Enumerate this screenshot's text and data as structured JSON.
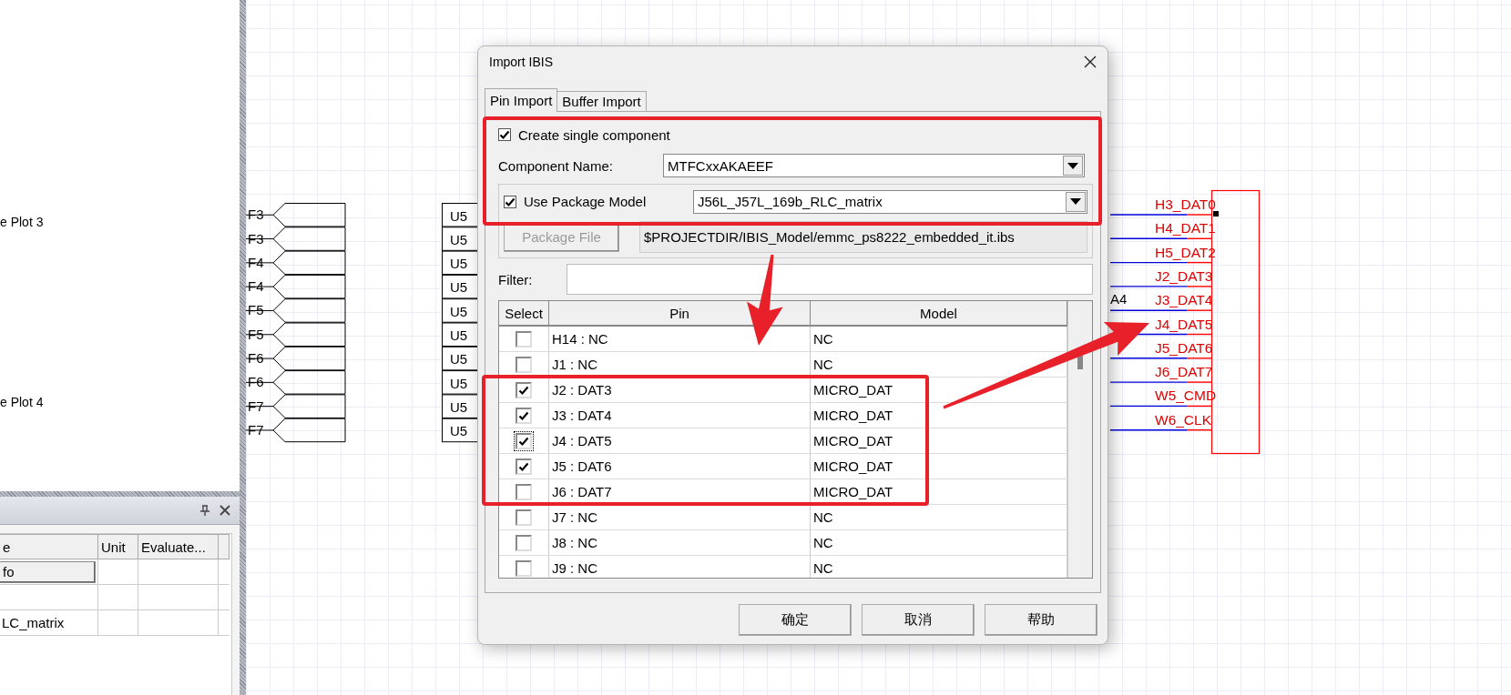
{
  "side_panel": {
    "items": [
      {
        "label": "e Plot 3"
      },
      {
        "label": "e Plot 4"
      }
    ]
  },
  "properties_panel": {
    "columns": [
      "e",
      "Unit",
      "Evaluate..."
    ],
    "rows": [
      {
        "kind": "button",
        "name": "fo"
      },
      {
        "kind": "empty"
      },
      {
        "kind": "text",
        "name": "LC_matrix"
      }
    ]
  },
  "schematic": {
    "ports": [
      "F3",
      "F3",
      "F4",
      "F4",
      "F5",
      "F5",
      "F6",
      "F6",
      "F7",
      "F7"
    ],
    "ref_boxes": [
      "U5",
      "U5",
      "U5",
      "U5",
      "U5",
      "U5",
      "U5",
      "U5",
      "U5",
      "U5"
    ],
    "net_label": "A4",
    "pins": [
      "H3_DAT0",
      "H4_DAT1",
      "H5_DAT2",
      "J2_DAT3",
      "J3_DAT4",
      "J4_DAT5",
      "J5_DAT6",
      "J6_DAT7",
      "W5_CMD",
      "W6_CLK"
    ]
  },
  "dialog": {
    "title": "Import IBIS",
    "tabs": [
      {
        "label": "Pin Import",
        "selected": true
      },
      {
        "label": "Buffer Import",
        "selected": false
      }
    ],
    "create_single": {
      "label": "Create single component",
      "checked": true
    },
    "component_name": {
      "label": "Component Name:",
      "value": "MTFCxxAKAEEF"
    },
    "use_package": {
      "label": "Use Package Model",
      "checked": true,
      "value": "J56L_J57L_169b_RLC_matrix"
    },
    "package_file": {
      "label": "Package File",
      "disabled": true,
      "value": "$PROJECTDIR/IBIS_Model/emmc_ps8222_embedded_it.ibs"
    },
    "filter": {
      "label": "Filter:"
    },
    "table": {
      "columns": [
        "Select",
        "Pin",
        "Model"
      ],
      "rows": [
        {
          "pin": "H14 : NC",
          "model": "NC",
          "checked": false,
          "focused": false
        },
        {
          "pin": "J1 : NC",
          "model": "NC",
          "checked": false,
          "focused": false
        },
        {
          "pin": "J2 : DAT3",
          "model": "MICRO_DAT",
          "checked": true,
          "focused": false
        },
        {
          "pin": "J3 : DAT4",
          "model": "MICRO_DAT",
          "checked": true,
          "focused": false
        },
        {
          "pin": "J4 : DAT5",
          "model": "MICRO_DAT",
          "checked": true,
          "focused": true
        },
        {
          "pin": "J5 : DAT6",
          "model": "MICRO_DAT",
          "checked": true,
          "focused": false
        },
        {
          "pin": "J6 : DAT7",
          "model": "MICRO_DAT",
          "checked": false,
          "focused": false
        },
        {
          "pin": "J7 : NC",
          "model": "NC",
          "checked": false,
          "focused": false
        },
        {
          "pin": "J8 : NC",
          "model": "NC",
          "checked": false,
          "focused": false
        },
        {
          "pin": "J9 : NC",
          "model": "NC",
          "checked": false,
          "focused": false
        }
      ]
    },
    "buttons": [
      "确定",
      "取消",
      "帮助"
    ]
  }
}
